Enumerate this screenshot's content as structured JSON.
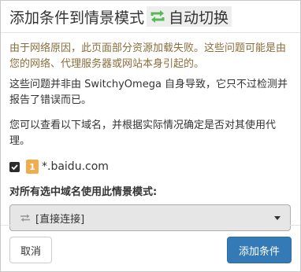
{
  "header": {
    "title": "添加条件到情景模式",
    "profile_name": "自动切换",
    "profile_icon": "sync-arrows-icon",
    "profile_icon_color": "#55bb55"
  },
  "body": {
    "warning": "由于网络原因，此页面部分资源加载失败。这些问题可能是由您的网络、代理服务器或网站本身引起的。",
    "note": "这些问题并非由 SwitchyOmega 自身导致，它只不过检测并报告了错误而已。",
    "instruction": "您可以查看以下域名，并根据实际情况确定是否对其使用代理。",
    "domains": [
      {
        "checked": true,
        "count": "1",
        "name": "*.baidu.com"
      }
    ],
    "select_label": "对所有选中域名使用此情景模式:",
    "select_value": "[直接连接]",
    "select_icon": "direct-connect-icon"
  },
  "footer": {
    "cancel_label": "取消",
    "add_label": "添加条件"
  },
  "colors": {
    "warning_text": "#8a6d3b",
    "badge": "#f0ad4e",
    "primary": "#337ab7"
  }
}
